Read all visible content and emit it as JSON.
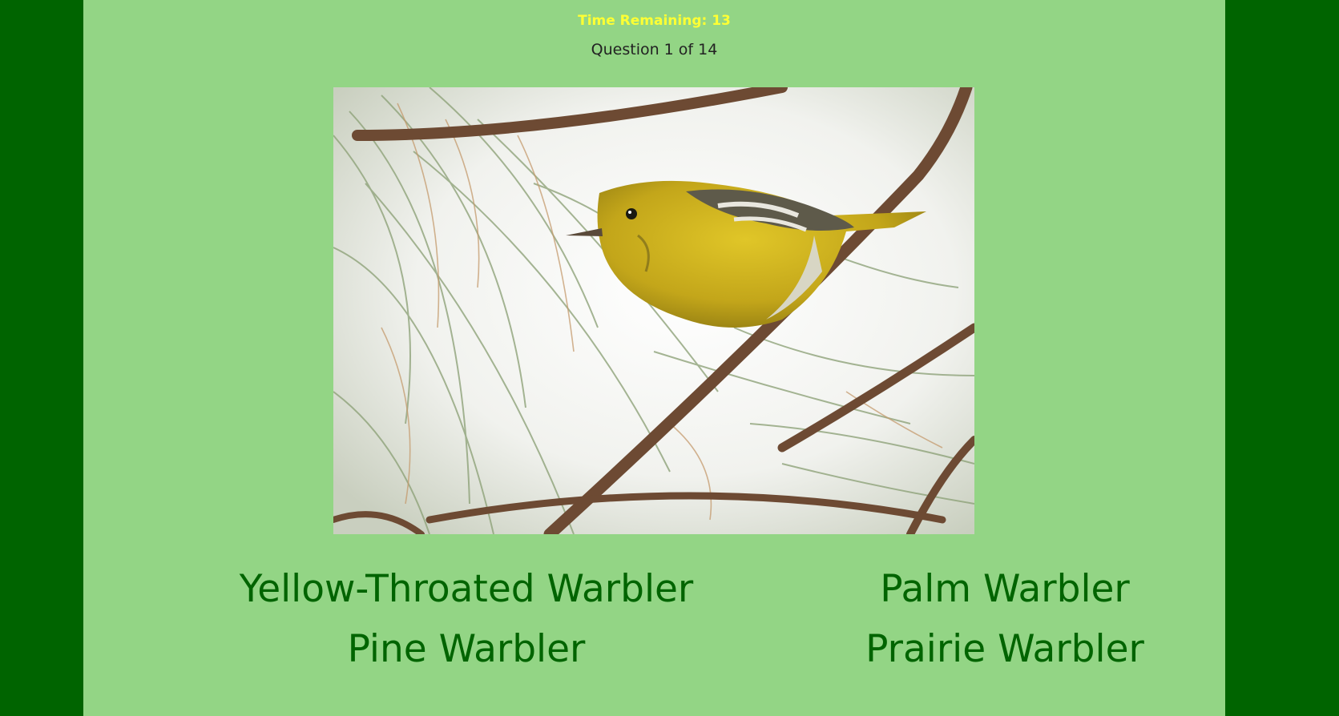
{
  "quiz": {
    "timer_text": "Time Remaining: 13",
    "question_text": "Question 1 of 14"
  },
  "answers": [
    {
      "label": "Yellow-Throated Warbler"
    },
    {
      "label": "Palm Warbler"
    },
    {
      "label": "Pine Warbler"
    },
    {
      "label": "Prairie Warbler"
    }
  ],
  "colors": {
    "outer_background": "#006400",
    "panel_background": "#93d585",
    "timer_text": "#ffff33",
    "answer_text": "#006400"
  }
}
